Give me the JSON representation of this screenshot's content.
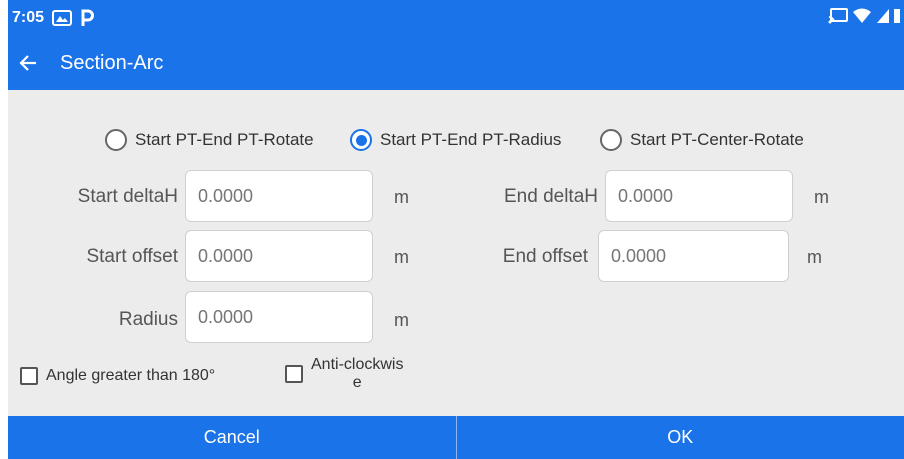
{
  "status_bar": {
    "time": "7:05",
    "icons": [
      "photos-icon",
      "parking-icon",
      "cast-icon",
      "wifi-icon",
      "signal-icon",
      "battery-icon"
    ]
  },
  "app_bar": {
    "title": "Section-Arc",
    "back_icon": "arrow-left-icon"
  },
  "mode_options": [
    {
      "label": "Start PT-End PT-Rotate",
      "selected": false
    },
    {
      "label": "Start PT-End PT-Radius",
      "selected": true
    },
    {
      "label": "Start PT-Center-Rotate",
      "selected": false
    }
  ],
  "fields": {
    "start_deltaH": {
      "label": "Start deltaH",
      "placeholder": "0.0000",
      "unit": "m"
    },
    "end_deltaH": {
      "label": "End deltaH",
      "placeholder": "0.0000",
      "unit": "m"
    },
    "start_offset": {
      "label": "Start offset",
      "placeholder": "0.0000",
      "unit": "m"
    },
    "end_offset": {
      "label": "End offset",
      "placeholder": "0.0000",
      "unit": "m"
    },
    "radius": {
      "label": "Radius",
      "placeholder": "0.0000",
      "unit": "m"
    }
  },
  "checkboxes": {
    "angle": {
      "label": "Angle greater than 180°",
      "checked": false
    },
    "anticlockwise": {
      "label_line1": "Anti-clockwis",
      "label_line2": "e",
      "checked": false
    }
  },
  "buttons": {
    "cancel": "Cancel",
    "ok": "OK"
  },
  "colors": {
    "primary": "#1a73e8",
    "background": "#ececec"
  }
}
